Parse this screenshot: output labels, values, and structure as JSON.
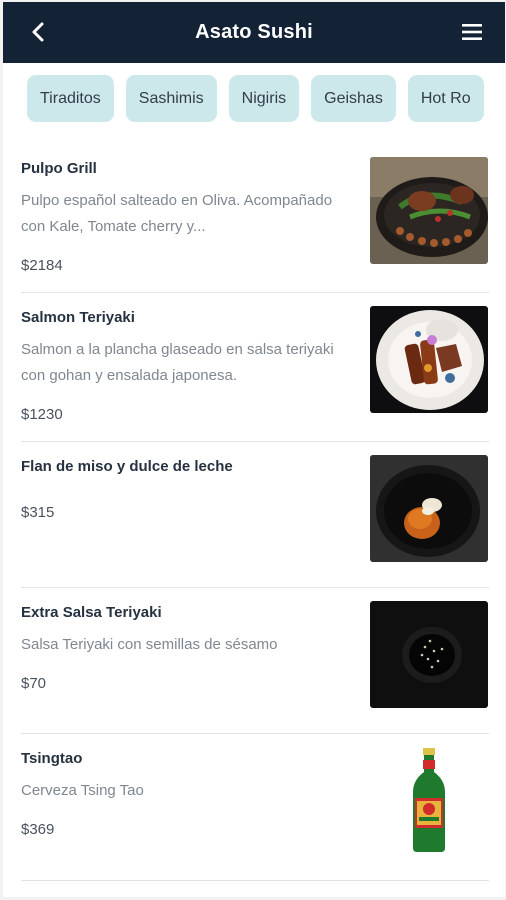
{
  "header": {
    "title": "Asato Sushi",
    "back_icon": "chevron-left-icon",
    "menu_icon": "hamburger-menu-icon",
    "background": "#142235"
  },
  "categories": [
    {
      "label": "Tiraditos"
    },
    {
      "label": "Sashimis"
    },
    {
      "label": "Nigiris"
    },
    {
      "label": "Geishas"
    },
    {
      "label": "Hot Ro"
    }
  ],
  "items": [
    {
      "name": "Pulpo Grill",
      "description": "Pulpo español salteado en Oliva. Acompañado con Kale, Tomate cherry y...",
      "price": "$2184",
      "image": "octopus-dish-photo"
    },
    {
      "name": "Salmon Teriyaki",
      "description": "Salmon a la plancha glaseado en salsa teriyaki con gohan y ensalada japonesa.",
      "price": "$1230",
      "image": "salmon-plate-photo"
    },
    {
      "name": "Flan de miso y dulce de leche",
      "description": "",
      "price": "$315",
      "image": "flan-bowl-photo"
    },
    {
      "name": "Extra Salsa Teriyaki",
      "description": "Salsa Teriyaki con semillas de sésamo",
      "price": "$70",
      "image": "sauce-bowl-photo"
    },
    {
      "name": "Tsingtao",
      "description": "Cerveza Tsing Tao",
      "price": "$369",
      "image": "beer-bottle-photo"
    }
  ],
  "colors": {
    "tab_background": "#cde8eb",
    "price_text": "#4a525c"
  }
}
